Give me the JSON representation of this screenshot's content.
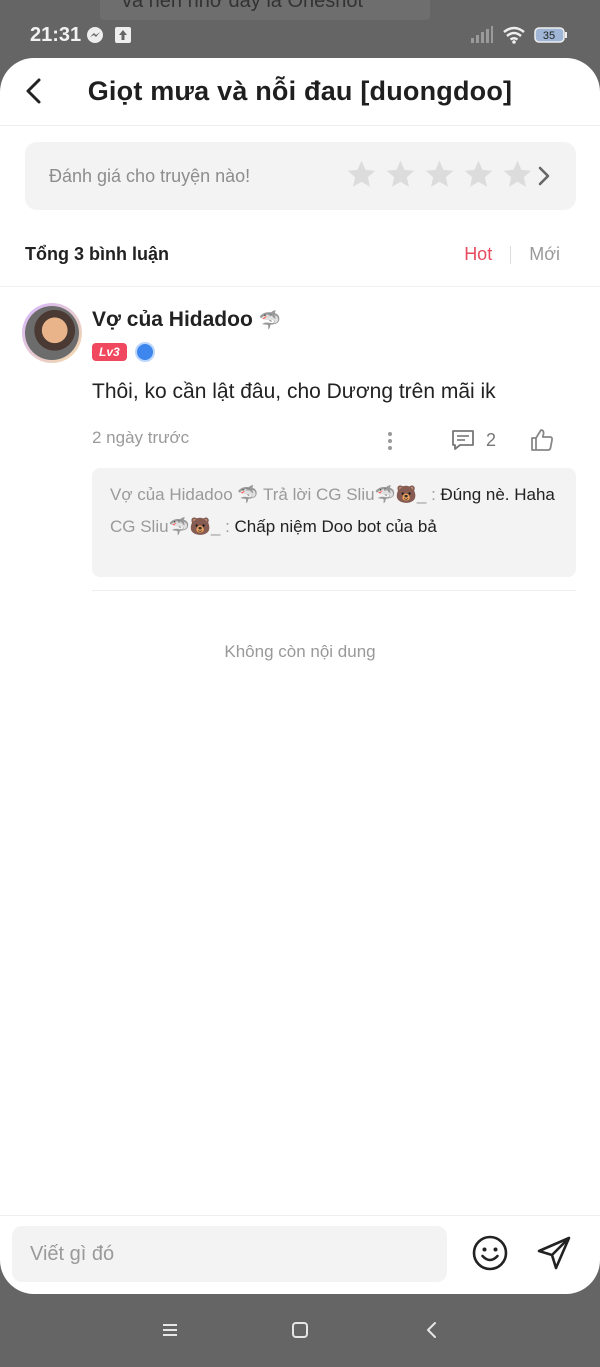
{
  "background": {
    "peek_text": "và nên nhớ đây là Oneshot"
  },
  "status_bar": {
    "time": "21:31",
    "battery": "35"
  },
  "header": {
    "title": "Giọt mưa và nỗi đau [duongdoo]"
  },
  "rating": {
    "prompt": "Đánh giá cho truyện nào!",
    "stars": 5
  },
  "comments_section": {
    "total_label": "Tổng 3 bình luận",
    "sort_hot": "Hot",
    "sort_new": "Mới"
  },
  "comment": {
    "author": "Vợ của Hidadoo",
    "author_emoji": "🦈",
    "level": "Lv3",
    "text": "Thôi, ko cần lật đâu, cho Dương trên mãi ik",
    "time": "2 ngày trước",
    "reply_count": "2",
    "replies": [
      {
        "prefix": "Vợ của Hidadoo 🦈 Trả lời CG Sliu🦈🐻_ : ",
        "body": "Đúng nè. Haha"
      },
      {
        "prefix": "CG Sliu🦈🐻_ : ",
        "body": "Chấp niệm Doo bot của bả"
      }
    ]
  },
  "footer_note": "Không còn nội dung",
  "composer": {
    "placeholder": "Viết gì đó"
  },
  "colors": {
    "accent": "#e84a5f",
    "level_badge": "#f0485e",
    "verify": "#3c86ee"
  }
}
